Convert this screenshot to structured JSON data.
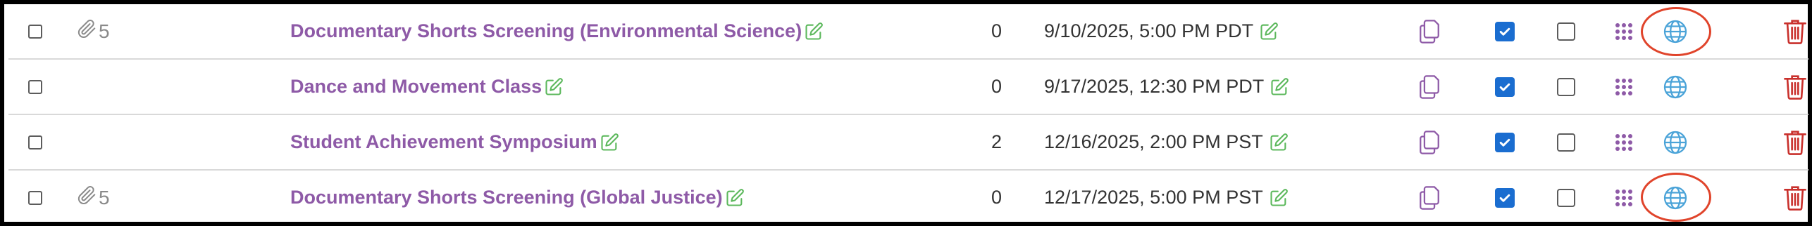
{
  "rows": [
    {
      "attachment_count": "5",
      "title": "Documentary Shorts Screening (Environmental Science)",
      "count": "0",
      "datetime": "9/10/2025, 5:00 PM PDT",
      "checked": true,
      "secondary_checked": false,
      "highlighted_globe": true
    },
    {
      "attachment_count": "",
      "title": "Dance and Movement Class",
      "count": "0",
      "datetime": "9/17/2025, 12:30 PM PDT",
      "checked": true,
      "secondary_checked": false,
      "highlighted_globe": false
    },
    {
      "attachment_count": "",
      "title": "Student Achievement Symposium",
      "count": "2",
      "datetime": "12/16/2025, 2:00 PM PST",
      "checked": true,
      "secondary_checked": false,
      "highlighted_globe": false
    },
    {
      "attachment_count": "5",
      "title": "Documentary Shorts Screening (Global Justice)",
      "count": "0",
      "datetime": "12/17/2025, 5:00 PM PST",
      "checked": true,
      "secondary_checked": false,
      "highlighted_globe": true
    }
  ],
  "colors": {
    "title": "#8e5aa7",
    "edit_icon": "#5cb85c",
    "copy_icon": "#8e5aa7",
    "checkbox_checked": "#1a6dd0",
    "drag_icon": "#8e5aa7",
    "globe_icon": "#4aa3d8",
    "trash_icon": "#c9302c",
    "highlight_ring": "#e0442b"
  },
  "icons": {
    "attachment": "paperclip-icon",
    "edit": "pencil-square-icon",
    "copy": "copy-icon",
    "drag": "drag-handle-icon",
    "globe": "globe-icon",
    "trash": "trash-icon"
  }
}
